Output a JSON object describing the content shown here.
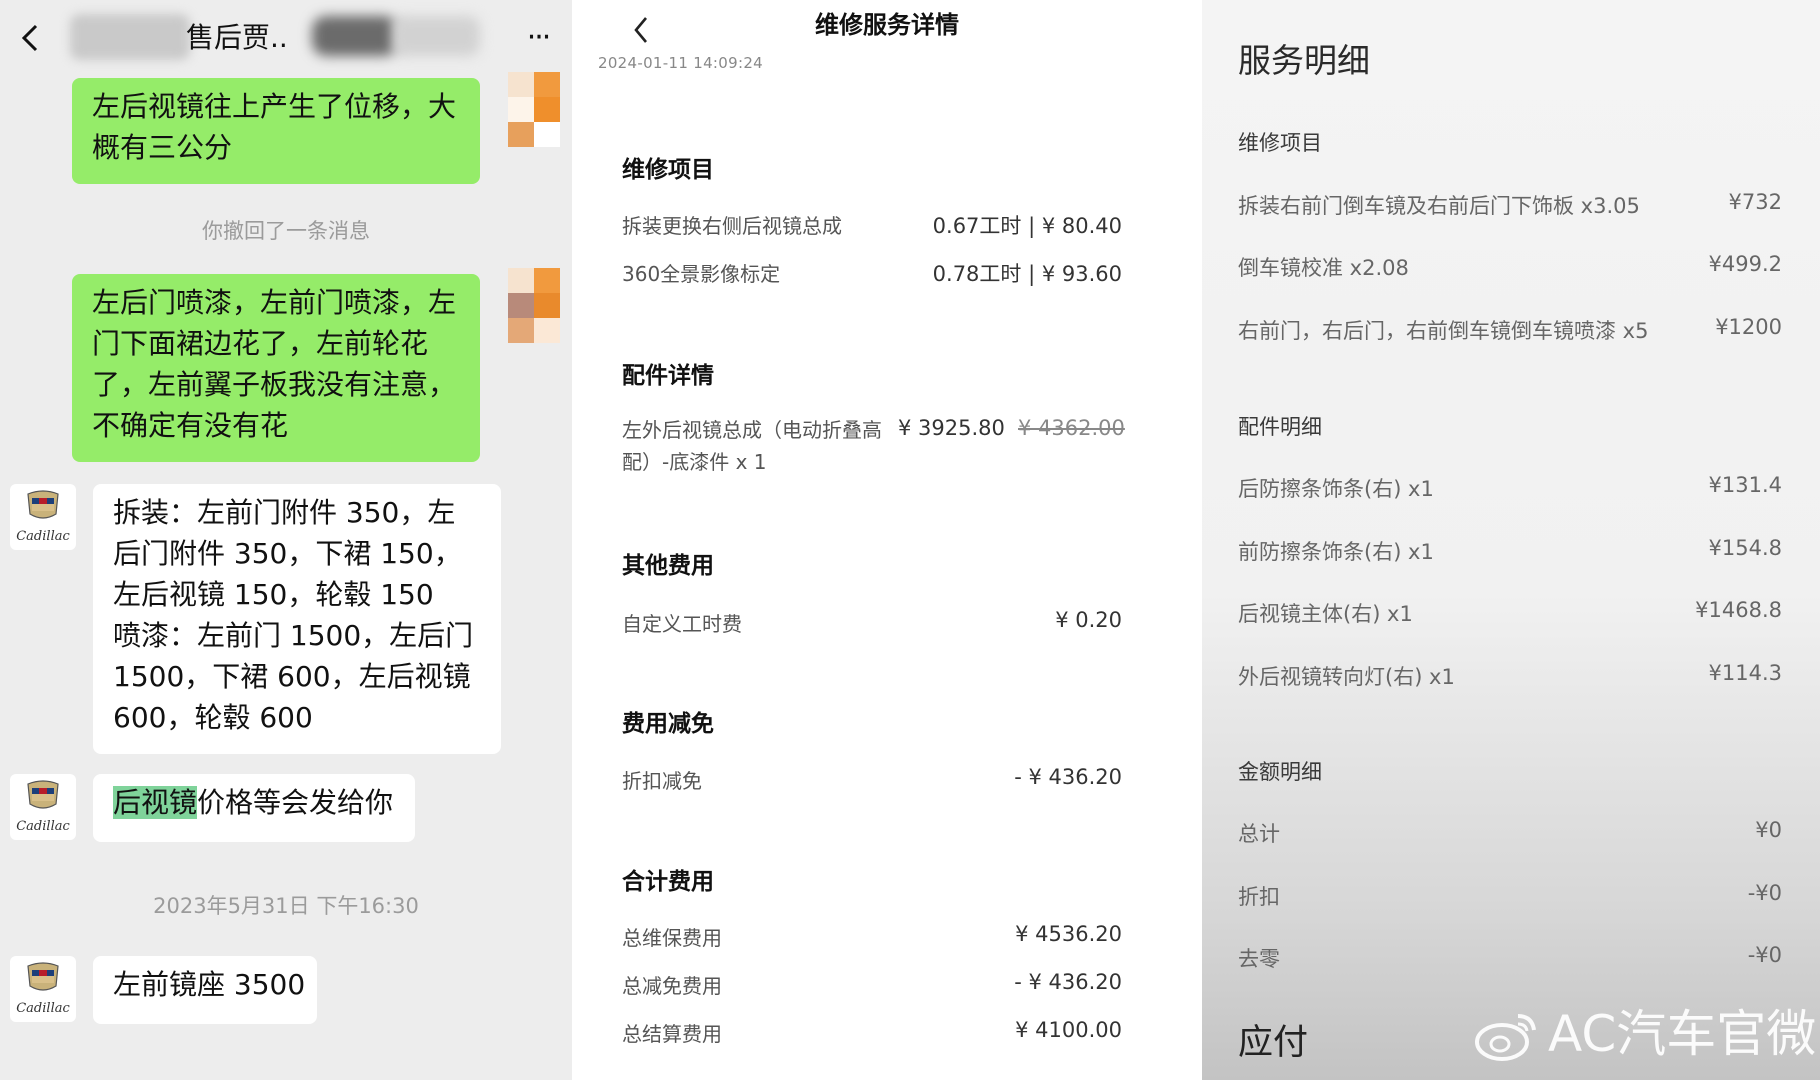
{
  "chat": {
    "title": "售后贾..",
    "more_label": "···",
    "back_label": "‹",
    "messages": [
      {
        "text": "左后视镜往上产生了位移，大概有三公分"
      },
      {
        "text": "你撤回了一条消息"
      },
      {
        "text": "左后门喷漆，左前门喷漆，左门下面裙边花了，左前轮花了，左前翼子板我没有注意，不确定有没有花"
      },
      {
        "text": "拆装：左前门附件 350，左后门附件 350，下裙 150，左后视镜 150，轮毂 150\n喷漆：左前门 1500，左后门 1500，下裙 600，左后视镜 600，轮毂 600"
      },
      {
        "highlight": "后视镜",
        "rest": "价格等会发给你"
      },
      {
        "text": "2023年5月31日 下午16:30"
      },
      {
        "text": "左前镜座 3500"
      }
    ],
    "avatar_brand": "Cadillac"
  },
  "detail": {
    "back_label": "‹",
    "title": "维修服务详情",
    "timestamp": "2024-01-11 14:09:24",
    "sections": {
      "repair": "维修项目",
      "parts": "配件详情",
      "other": "其他费用",
      "discount": "费用减免",
      "total": "合计费用"
    },
    "repair_items": [
      {
        "name": "拆装更换右侧后视镜总成",
        "value": "0.67工时 | ¥ 80.40"
      },
      {
        "name": "360全景影像标定",
        "value": "0.78工时 | ¥ 93.60"
      }
    ],
    "part": {
      "name": "左外后视镜总成（电动折叠高配）-底漆件 x 1",
      "price": "¥ 3925.80",
      "original_price": "¥ 4362.00"
    },
    "other_items": [
      {
        "name": "自定义工时费",
        "value": "¥ 0.20"
      }
    ],
    "discount_items": [
      {
        "name": "折扣减免",
        "value": "- ¥ 436.20"
      }
    ],
    "total_items": [
      {
        "name": "总维保费用",
        "value": "¥ 4536.20"
      },
      {
        "name": "总减免费用",
        "value": "- ¥ 436.20"
      },
      {
        "name": "总结算费用",
        "value": "¥ 4100.00"
      }
    ]
  },
  "service": {
    "title": "服务明细",
    "repair_header": "维修项目",
    "repair_items": [
      {
        "name": "拆装右前门倒车镜及右前后门下饰板  x3.05",
        "value": "¥732"
      },
      {
        "name": "倒车镜校准  x2.08",
        "value": "¥499.2"
      },
      {
        "name": "右前门，右后门，右前倒车镜倒车镜喷漆  x5",
        "value": "¥1200"
      }
    ],
    "parts_header": "配件明细",
    "parts_items": [
      {
        "name": "后防擦条饰条(右)  x1",
        "value": "¥131.4"
      },
      {
        "name": "前防擦条饰条(右)  x1",
        "value": "¥154.8"
      },
      {
        "name": "后视镜主体(右)  x1",
        "value": "¥1468.8"
      },
      {
        "name": "外后视镜转向灯(右)  x1",
        "value": "¥114.3"
      }
    ],
    "amount_header": "金额明细",
    "amount_items": [
      {
        "name": "总计",
        "value": "¥0"
      },
      {
        "name": "折扣",
        "value": "-¥0"
      },
      {
        "name": "去零",
        "value": "-¥0"
      }
    ],
    "payable_label": "应付"
  },
  "watermark": {
    "text": "AC汽车官微",
    "icon": "weibo-icon"
  }
}
